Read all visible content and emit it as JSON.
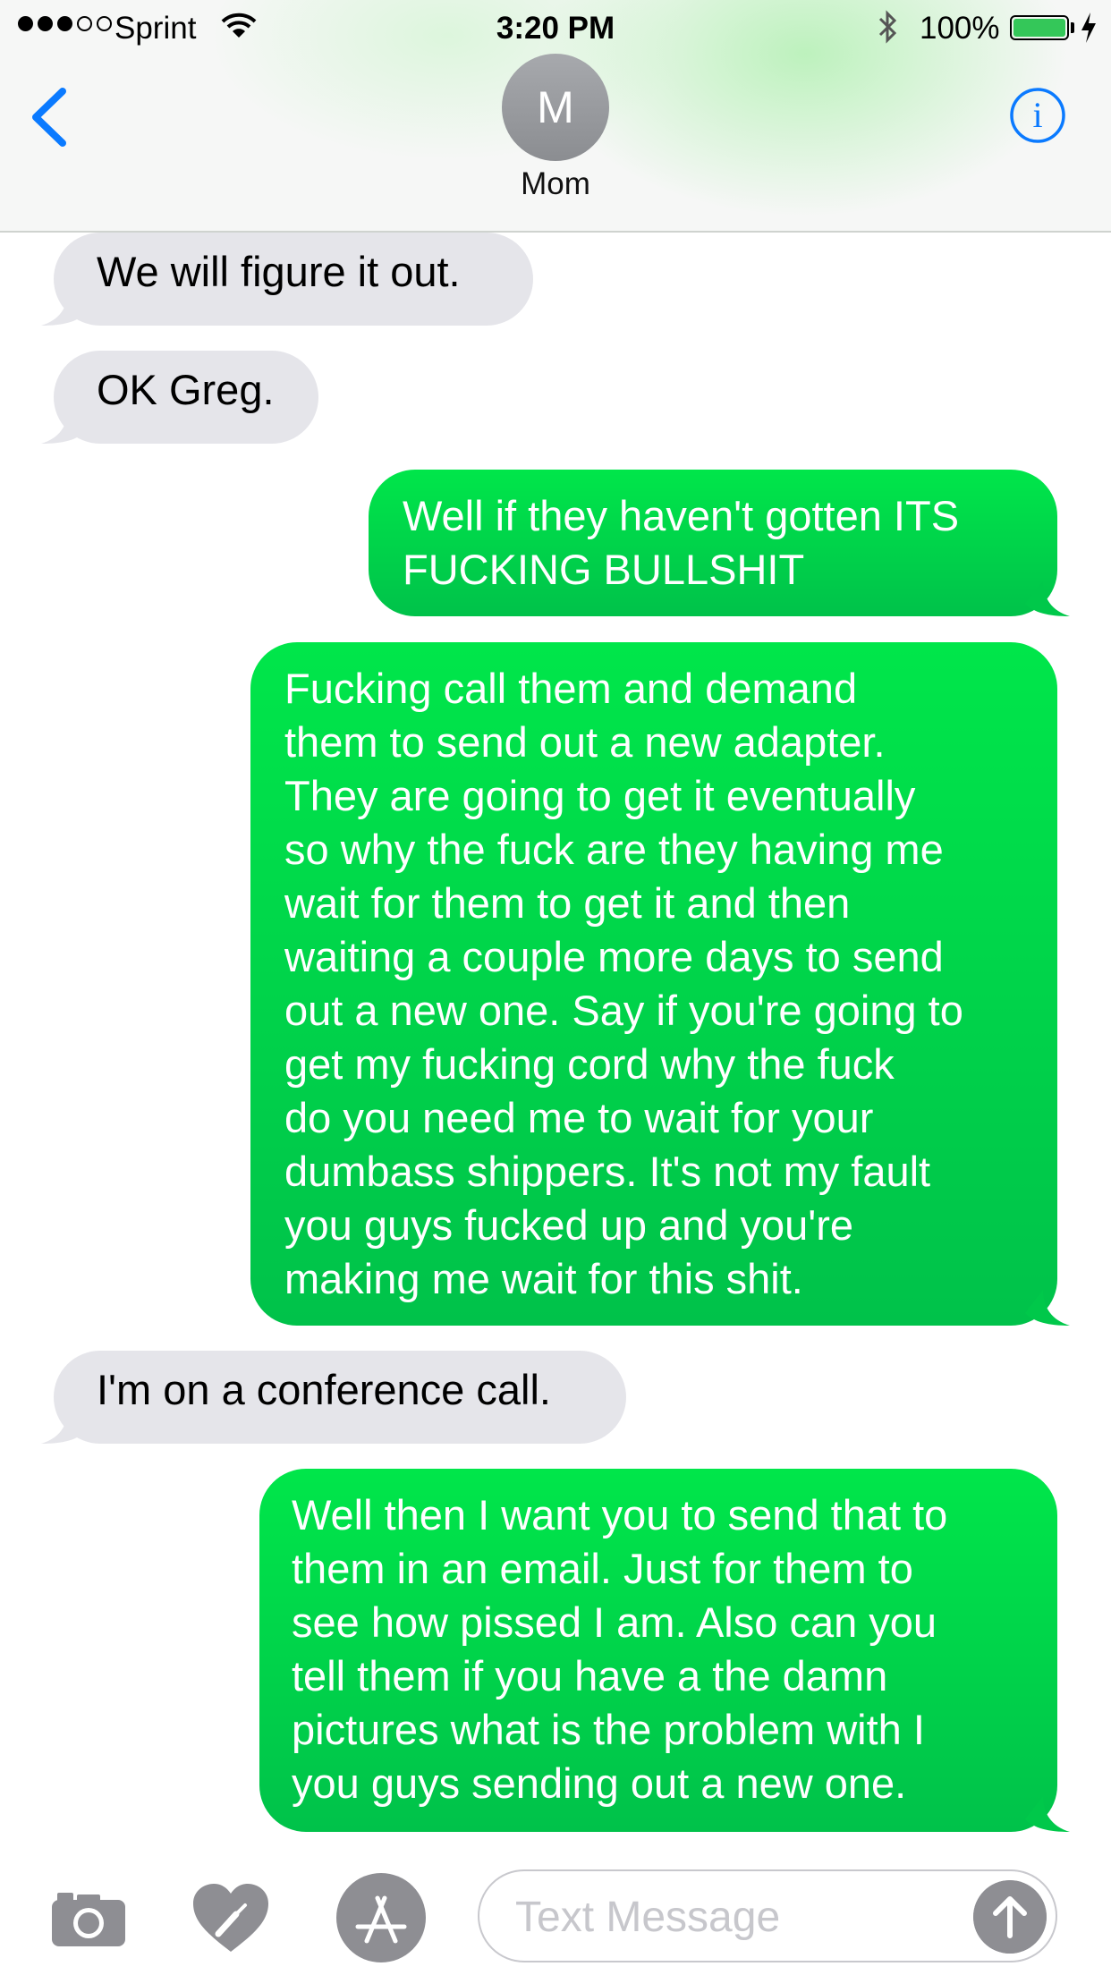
{
  "status_bar": {
    "carrier": "Sprint",
    "time": "3:20 PM",
    "battery": "100%",
    "signal_bars_filled": 3,
    "signal_bars_total": 5,
    "battery_level": 1.0
  },
  "nav": {
    "avatar_initial": "M",
    "contact_name": "Mom"
  },
  "messages": [
    {
      "direction": "received",
      "text": "We will figure it out."
    },
    {
      "direction": "received",
      "text": "OK Greg."
    },
    {
      "direction": "sent",
      "text": "Well if they haven't gotten ITS\nFUCKING BULLSHIT"
    },
    {
      "direction": "sent",
      "text": "Fucking call them and demand\nthem to send out a new adapter.\nThey are going to get it eventually\nso why the fuck are they having me\nwait for them to get it and then\nwaiting a couple more days to send\nout a new one. Say if you're going to\nget my fucking cord why the fuck\ndo you need me to wait for your\ndumbass shippers. It's not my fault\nyou guys fucked up and you're\nmaking me wait for this shit."
    },
    {
      "direction": "received",
      "text": "I'm on a conference call."
    },
    {
      "direction": "sent",
      "text": "Well then I want you to send that to\nthem in an email. Just for them to\nsee how pissed I am. Also can you\ntell them if you have a the damn\npictures what is the problem with I\nyou guys sending out a new one."
    }
  ],
  "input_bar": {
    "placeholder": "Text Message"
  },
  "colors": {
    "sent_bubble": "#00d64a",
    "received_bubble": "#e5e5ea",
    "accent": "#0a7aff"
  },
  "icons": [
    "back-chevron-icon",
    "info-icon",
    "camera-icon",
    "digital-touch-heart-icon",
    "app-store-icon",
    "send-arrow-icon",
    "wifi-icon",
    "bluetooth-icon",
    "battery-icon",
    "charging-bolt-icon"
  ]
}
